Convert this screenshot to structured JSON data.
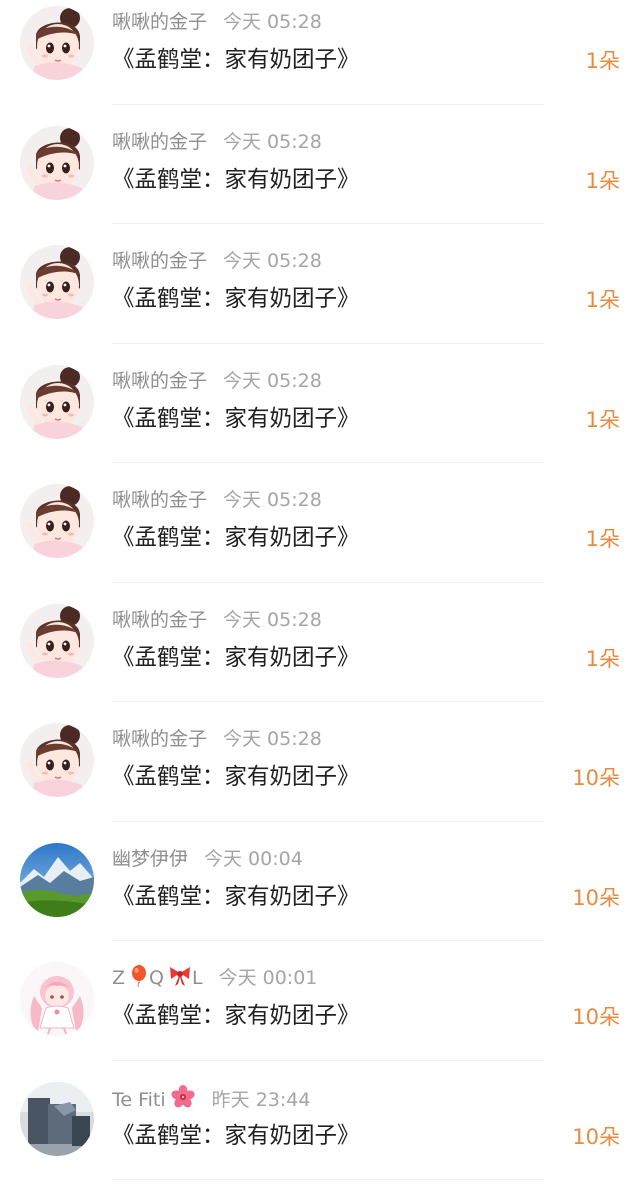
{
  "gift_list": [
    {
      "user": "啾啾的金子",
      "time": "今天 05:28",
      "message": "《孟鹤堂：家有奶团子》",
      "count": "1朵",
      "avatar": "anime-girl-avatar"
    },
    {
      "user": "啾啾的金子",
      "time": "今天 05:28",
      "message": "《孟鹤堂：家有奶团子》",
      "count": "1朵",
      "avatar": "anime-girl-avatar"
    },
    {
      "user": "啾啾的金子",
      "time": "今天 05:28",
      "message": "《孟鹤堂：家有奶团子》",
      "count": "1朵",
      "avatar": "anime-girl-avatar"
    },
    {
      "user": "啾啾的金子",
      "time": "今天 05:28",
      "message": "《孟鹤堂：家有奶团子》",
      "count": "1朵",
      "avatar": "anime-girl-avatar"
    },
    {
      "user": "啾啾的金子",
      "time": "今天 05:28",
      "message": "《孟鹤堂：家有奶团子》",
      "count": "1朵",
      "avatar": "anime-girl-avatar"
    },
    {
      "user": "啾啾的金子",
      "time": "今天 05:28",
      "message": "《孟鹤堂：家有奶团子》",
      "count": "1朵",
      "avatar": "anime-girl-avatar"
    },
    {
      "user": "啾啾的金子",
      "time": "今天 05:28",
      "message": "《孟鹤堂：家有奶团子》",
      "count": "10朵",
      "avatar": "anime-girl-avatar"
    },
    {
      "user": "幽梦伊伊",
      "time": "今天 00:04",
      "message": "《孟鹤堂：家有奶团子》",
      "count": "10朵",
      "avatar": "mountain-landscape-avatar"
    },
    {
      "user": "Z",
      "time": "今天 00:01",
      "message": "《孟鹤堂：家有奶团子》",
      "count": "10朵",
      "avatar": "pink-anime-girl-avatar",
      "name_parts": [
        "Z",
        "Q",
        "L"
      ],
      "name_emojis": [
        "balloon-emoji",
        "ribbon-emoji"
      ]
    },
    {
      "user": "Te Fiti",
      "time": "昨天 23:44",
      "message": "《孟鹤堂：家有奶团子》",
      "count": "10朵",
      "avatar": "photo-avatar",
      "name_emojis": [
        "flower-emoji"
      ]
    }
  ],
  "colors": {
    "count": "#e88b3f",
    "username": "#8f8f8f",
    "timestamp": "#a5a5a5",
    "message": "#202020",
    "divider": "#f2f2f2"
  }
}
